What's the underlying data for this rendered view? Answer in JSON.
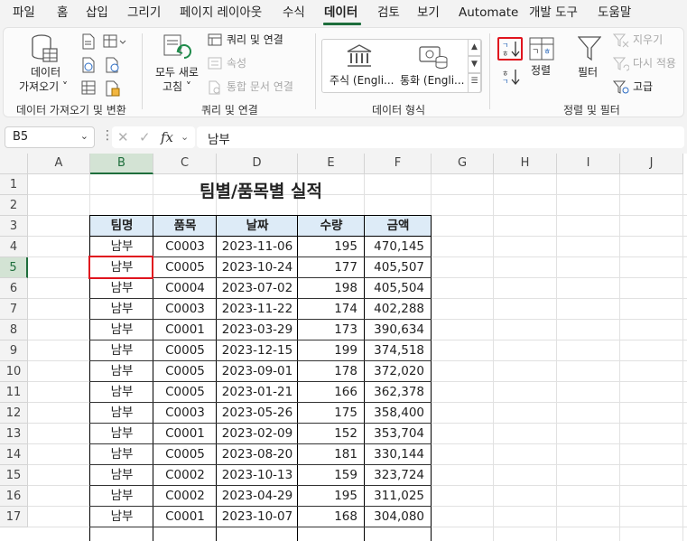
{
  "menu": {
    "tabs": [
      "파일",
      "홈",
      "삽입",
      "그리기",
      "페이지 레이아웃",
      "수식",
      "데이터",
      "검토",
      "보기",
      "Automate",
      "개발 도구",
      "도움말"
    ],
    "active_tab": "데이터"
  },
  "ribbon": {
    "get_data": {
      "line1": "데이터",
      "line2": "가져오기 ˅"
    },
    "refresh_all": {
      "line1": "모두 새로",
      "line2": "고침 ˅"
    },
    "queries_connections": "쿼리 및 연결",
    "properties": "속성",
    "edit_links": "통합 문서 연결",
    "stocks": "주식 (Engli...",
    "currencies": "통화 (Engli...",
    "sort_label": "정렬",
    "filter_label": "필터",
    "clear_label": "지우기",
    "reapply_label": "다시 적용",
    "advanced_label": "고급",
    "groups": {
      "get_transform": "데이터 가져오기 및 변환",
      "queries": "쿼리 및 연결",
      "data_types": "데이터 형식",
      "sort_filter": "정렬 및 필터"
    }
  },
  "formula_bar": {
    "name_box": "B5",
    "formula": "남부"
  },
  "sheet": {
    "columns": [
      "A",
      "B",
      "C",
      "D",
      "E",
      "F",
      "G",
      "H",
      "I",
      "J"
    ],
    "rows": [
      "1",
      "2",
      "3",
      "4",
      "5",
      "6",
      "7",
      "8",
      "9",
      "10",
      "11",
      "12",
      "13",
      "14",
      "15",
      "16",
      "17"
    ],
    "title": "팀별/품목별 실적",
    "headers": [
      "팀명",
      "품목",
      "날짜",
      "수량",
      "금액"
    ],
    "data": [
      [
        "남부",
        "C0003",
        "2023-11-06",
        "195",
        "470,145"
      ],
      [
        "남부",
        "C0005",
        "2023-10-24",
        "177",
        "405,507"
      ],
      [
        "남부",
        "C0004",
        "2023-07-02",
        "198",
        "405,504"
      ],
      [
        "남부",
        "C0003",
        "2023-11-22",
        "174",
        "402,288"
      ],
      [
        "남부",
        "C0001",
        "2023-03-29",
        "173",
        "390,634"
      ],
      [
        "남부",
        "C0005",
        "2023-12-15",
        "199",
        "374,518"
      ],
      [
        "남부",
        "C0005",
        "2023-09-01",
        "178",
        "372,020"
      ],
      [
        "남부",
        "C0005",
        "2023-01-21",
        "166",
        "362,378"
      ],
      [
        "남부",
        "C0003",
        "2023-05-26",
        "175",
        "358,400"
      ],
      [
        "남부",
        "C0001",
        "2023-02-09",
        "152",
        "353,704"
      ],
      [
        "남부",
        "C0005",
        "2023-08-20",
        "181",
        "330,144"
      ],
      [
        "남부",
        "C0002",
        "2023-10-13",
        "159",
        "323,724"
      ],
      [
        "남부",
        "C0002",
        "2023-04-29",
        "195",
        "311,025"
      ],
      [
        "남부",
        "C0001",
        "2023-10-07",
        "168",
        "304,080"
      ]
    ],
    "selected_cell": "B5"
  },
  "colors": {
    "accent": "#1e6e3c",
    "header_fill": "#ddebf7",
    "highlight": "#e0141e"
  }
}
